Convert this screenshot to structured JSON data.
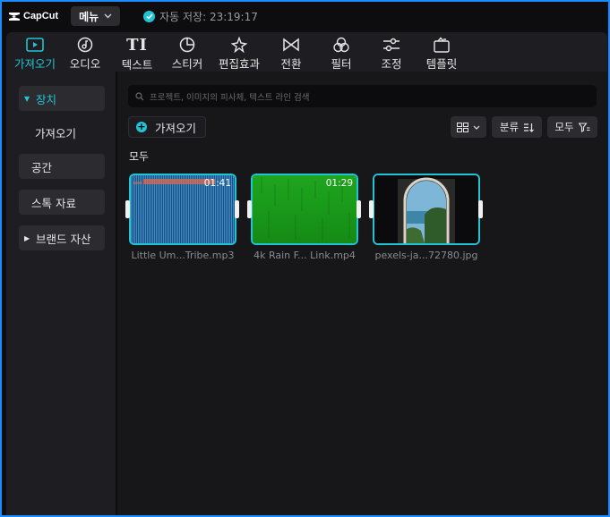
{
  "app": {
    "logo_text": "CapCut"
  },
  "titlebar": {
    "menu_label": "메뉴",
    "autosave_label": "자동 저장: 23:19:17"
  },
  "tabs": [
    {
      "label": "가져오기",
      "icon": "media-play-icon",
      "active": true
    },
    {
      "label": "오디오",
      "icon": "music-note-icon"
    },
    {
      "label": "텍스트",
      "icon": "text-icon"
    },
    {
      "label": "스티커",
      "icon": "sticker-icon"
    },
    {
      "label": "편집효과",
      "icon": "sparkle-icon"
    },
    {
      "label": "전환",
      "icon": "transition-icon"
    },
    {
      "label": "필터",
      "icon": "filter-icon"
    },
    {
      "label": "조정",
      "icon": "adjust-sliders-icon"
    },
    {
      "label": "템플릿",
      "icon": "template-icon"
    }
  ],
  "sidebar": {
    "items": [
      {
        "label": "장치",
        "active": true
      },
      {
        "label": "가져오기"
      },
      {
        "label": "공간"
      },
      {
        "label": "스톡 자료"
      },
      {
        "label": "브랜드 자산"
      }
    ]
  },
  "main": {
    "search_placeholder": "프로젝트, 이미지의 피사체, 텍스트 라인 검색",
    "import_label": "가져오기",
    "sort_label": "분류",
    "filter_label": "모두",
    "section_label": "모두",
    "media": [
      {
        "type": "audio",
        "name": "Little Um...Tribe.mp3",
        "duration": "01:41"
      },
      {
        "type": "video",
        "name": "4k Rain F... Link.mp4",
        "duration": "01:29"
      },
      {
        "type": "image",
        "name": "pexels-ja...72780.jpg"
      }
    ]
  },
  "colors": {
    "accent": "#22c4d4",
    "window_border": "#1a8cff"
  }
}
